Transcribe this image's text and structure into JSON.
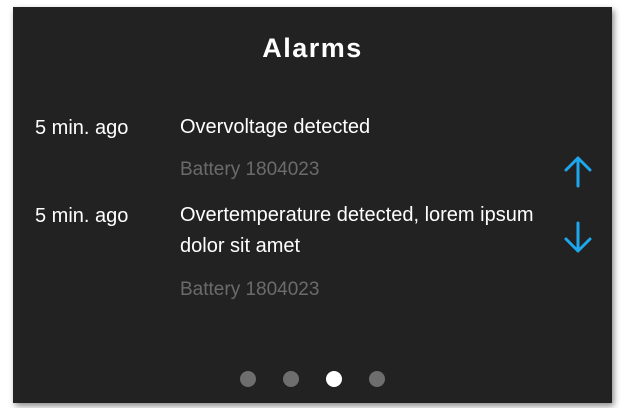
{
  "header": {
    "title": "Alarms"
  },
  "alarms": [
    {
      "time": "5 min. ago",
      "message": "Overvoltage detected",
      "source": "Battery 1804023"
    },
    {
      "time": "5 min. ago",
      "message": "Overtemperature detected, lorem ipsum dolor sit amet",
      "source": "Battery 1804023"
    }
  ],
  "navigation": {
    "up_icon": "arrow-up-icon",
    "down_icon": "arrow-down-icon",
    "accent_color": "#1ea7ec"
  },
  "pagination": {
    "total_pages": 4,
    "current_page": 3
  }
}
